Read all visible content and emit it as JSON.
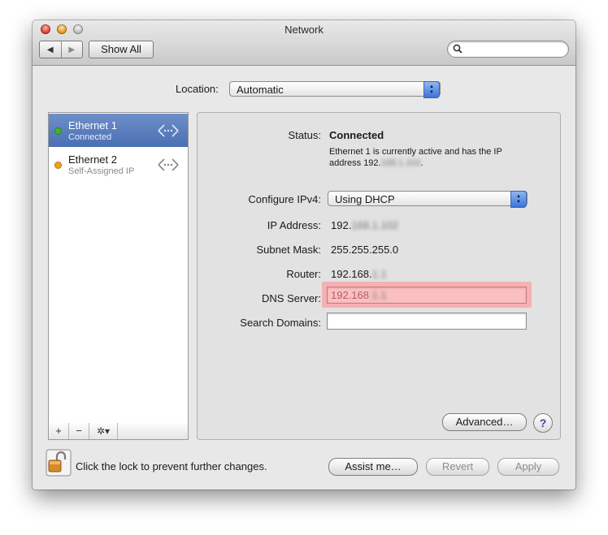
{
  "window": {
    "title": "Network"
  },
  "toolbar": {
    "back_glyph": "◀",
    "forward_glyph": "▶",
    "show_all_label": "Show All",
    "search_placeholder": "",
    "search_value": ""
  },
  "location": {
    "label": "Location:",
    "value": "Automatic"
  },
  "services": [
    {
      "name": "Ethernet 1",
      "status": "Connected",
      "indicator_color": "#3fb42b",
      "selected": true
    },
    {
      "name": "Ethernet 2",
      "status": "Self-Assigned IP",
      "indicator_color": "#f0a21b",
      "selected": false
    }
  ],
  "sidebar_tools": {
    "add": "+",
    "remove": "−",
    "action": "✲▾"
  },
  "detail": {
    "status_label": "Status:",
    "status_value": "Connected",
    "status_description_prefix": "Ethernet 1 is currently active and has the IP address 192.",
    "status_description_redacted": "168.1.102",
    "status_description_suffix": ".",
    "configure_label": "Configure IPv4:",
    "configure_value": "Using DHCP",
    "ip_label": "IP Address:",
    "ip_prefix": "192.",
    "ip_redacted": "168.1.102",
    "subnet_label": "Subnet Mask:",
    "subnet_value": "255.255.255.0",
    "router_label": "Router:",
    "router_prefix": "192.168.",
    "router_redacted": "1.1",
    "dns_label": "DNS Server:",
    "dns_prefix": "192.168",
    "dns_redacted": ".1.1",
    "search_domains_label": "Search Domains:",
    "search_domains_value": ""
  },
  "buttons": {
    "advanced": "Advanced…",
    "help": "?",
    "assist": "Assist me…",
    "revert": "Revert",
    "apply": "Apply"
  },
  "lock": {
    "text": "Click the lock to prevent further changes."
  }
}
